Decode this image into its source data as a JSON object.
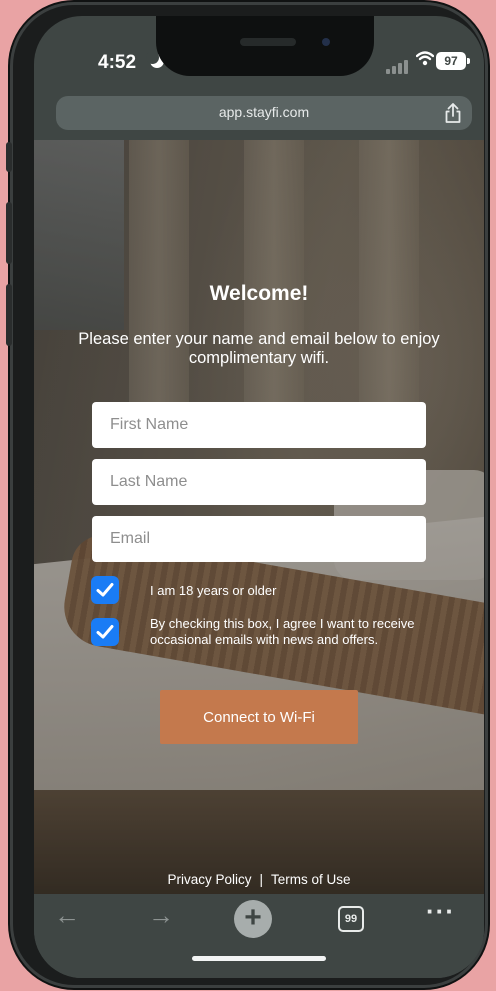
{
  "status_bar": {
    "time": "4:52",
    "battery": "97",
    "icons": [
      "moon-icon",
      "signal-icon",
      "wifi-icon",
      "battery-icon"
    ]
  },
  "browser": {
    "url": "app.stayfi.com",
    "share_icon": "share-icon",
    "tabs_count": "99",
    "toolbar_icons": [
      "back-arrow-icon",
      "forward-arrow-icon",
      "plus-icon",
      "tabs-icon",
      "more-icon"
    ]
  },
  "portal": {
    "title": "Welcome!",
    "intro": "Please enter your name and email below to enjoy complimentary wifi.",
    "first_name_placeholder": "First Name",
    "last_name_placeholder": "Last Name",
    "email_placeholder": "Email",
    "age_checkbox_label": "I am 18 years or older",
    "age_checked": true,
    "consent_checkbox_label": "By checking this box, I agree I want to receive occasional emails with news and offers.",
    "consent_checked": true,
    "cta_label": "Connect to Wi-Fi",
    "cta_color": "#c4794d",
    "checkbox_color": "#1a7cf5"
  },
  "footer": {
    "privacy": "Privacy Policy",
    "separator": "|",
    "terms": "Terms of Use"
  },
  "colors": {
    "page_background": "#e9a3a4",
    "browser_chrome": "#3f4644"
  }
}
